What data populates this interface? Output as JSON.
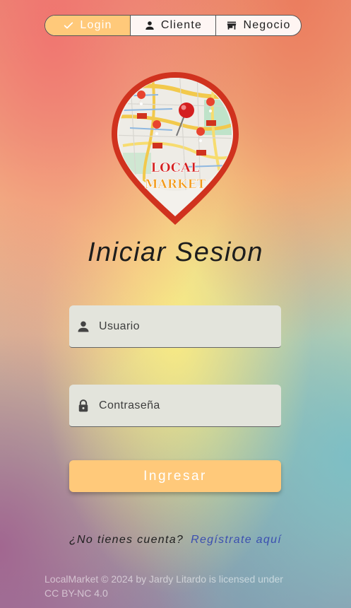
{
  "tabs": [
    {
      "label": "Login",
      "icon": "check-icon",
      "selected": true
    },
    {
      "label": "Cliente",
      "icon": "person-icon",
      "selected": false
    },
    {
      "label": "Negocio",
      "icon": "store-icon",
      "selected": false
    }
  ],
  "logo": {
    "line1": "LOCAL",
    "line2": "MARKET"
  },
  "title": "Iniciar Sesion",
  "form": {
    "username_placeholder": "Usuario",
    "password_placeholder": "Contraseña",
    "submit_label": "Ingresar"
  },
  "signup": {
    "question": "¿No tienes cuenta?",
    "link": "Regístrate aquí"
  },
  "footer": {
    "line1": "LocalMarket © 2024 by Jardy Litardo is licensed under",
    "line2": "CC BY-NC 4.0"
  },
  "colors": {
    "accent": "#ffc97a",
    "link": "#3b4fb0",
    "field_bg": "#e3e4dc"
  }
}
